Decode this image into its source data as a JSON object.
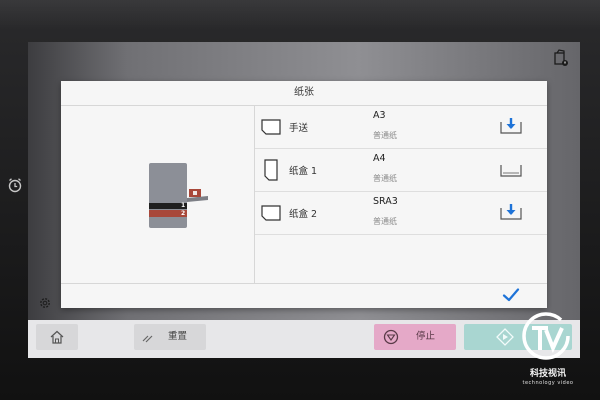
{
  "dialog": {
    "title": "纸张"
  },
  "trays": [
    {
      "name": "手送",
      "size": "A3",
      "paper_type": "普通纸",
      "status_icon": "tray-loaded-icon"
    },
    {
      "name": "纸盒 1",
      "size": "A4",
      "paper_type": "普通纸",
      "status_icon": "tray-empty-icon"
    },
    {
      "name": "纸盒 2",
      "size": "SRA3",
      "paper_type": "普通纸",
      "status_icon": "tray-loaded-icon"
    }
  ],
  "machine_diagram": {
    "labels": [
      "1",
      "2"
    ]
  },
  "bottom_bar": {
    "reset_label": "重置",
    "stop_label": "停止"
  },
  "colors": {
    "accent": "#1e73d8",
    "stop_button": "#e5a9c8",
    "start_button": "#a9d6d1",
    "selected_tray": "#a8483a"
  },
  "watermark": {
    "title": "科技视讯"
  }
}
